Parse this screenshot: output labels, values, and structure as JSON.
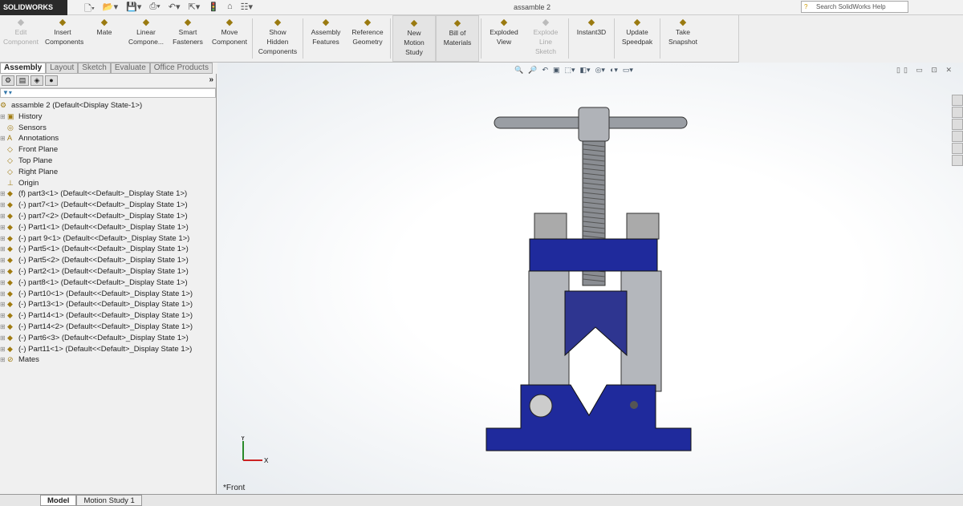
{
  "app": {
    "logo": "SOLIDWORKS",
    "title": "assamble 2",
    "search_placeholder": "Search SolidWorks Help"
  },
  "ribbon": [
    {
      "label": "Edit Component",
      "disabled": true
    },
    {
      "label": "Insert Components"
    },
    {
      "label": "Mate"
    },
    {
      "label": "Linear Compone..."
    },
    {
      "label": "Smart Fasteners"
    },
    {
      "label": "Move Component"
    },
    {
      "label": "Show Hidden Components"
    },
    {
      "label": "Assembly Features"
    },
    {
      "label": "Reference Geometry"
    },
    {
      "label": "New Motion Study",
      "active": true
    },
    {
      "label": "Bill of Materials",
      "active": true
    },
    {
      "label": "Exploded View"
    },
    {
      "label": "Explode Line Sketch",
      "disabled": true
    },
    {
      "label": "Instant3D"
    },
    {
      "label": "Update Speedpak"
    },
    {
      "label": "Take Snapshot"
    }
  ],
  "tabs": [
    "Assembly",
    "Layout",
    "Sketch",
    "Evaluate",
    "Office Products"
  ],
  "tree": [
    {
      "label": "assamble 2  (Default<Display State-1>)",
      "icon": "assembly",
      "root": true
    },
    {
      "label": "History",
      "icon": "history",
      "exp": true
    },
    {
      "label": "Sensors",
      "icon": "sensor"
    },
    {
      "label": "Annotations",
      "icon": "annotation",
      "exp": true
    },
    {
      "label": "Front Plane",
      "icon": "plane"
    },
    {
      "label": "Top Plane",
      "icon": "plane"
    },
    {
      "label": "Right Plane",
      "icon": "plane"
    },
    {
      "label": "Origin",
      "icon": "origin"
    },
    {
      "label": "(f) part3<1> (Default<<Default>_Display State 1>)",
      "icon": "part",
      "exp": true
    },
    {
      "label": "(-) part7<1> (Default<<Default>_Display State 1>)",
      "icon": "part",
      "exp": true
    },
    {
      "label": "(-) part7<2> (Default<<Default>_Display State 1>)",
      "icon": "part",
      "exp": true
    },
    {
      "label": "(-) Part1<1> (Default<<Default>_Display State 1>)",
      "icon": "part",
      "exp": true
    },
    {
      "label": "(-) part 9<1> (Default<<Default>_Display State 1>)",
      "icon": "part",
      "exp": true
    },
    {
      "label": "(-) Part5<1> (Default<<Default>_Display State 1>)",
      "icon": "part",
      "exp": true
    },
    {
      "label": "(-) Part5<2> (Default<<Default>_Display State 1>)",
      "icon": "part",
      "exp": true
    },
    {
      "label": "(-) Part2<1> (Default<<Default>_Display State 1>)",
      "icon": "part",
      "exp": true
    },
    {
      "label": "(-) part8<1> (Default<<Default>_Display State 1>)",
      "icon": "part",
      "exp": true
    },
    {
      "label": "(-) Part10<1> (Default<<Default>_Display State 1>)",
      "icon": "part",
      "exp": true
    },
    {
      "label": "(-) Part13<1> (Default<<Default>_Display State 1>)",
      "icon": "part",
      "exp": true
    },
    {
      "label": "(-) Part14<1> (Default<<Default>_Display State 1>)",
      "icon": "part",
      "exp": true
    },
    {
      "label": "(-) Part14<2> (Default<<Default>_Display State 1>)",
      "icon": "part",
      "exp": true
    },
    {
      "label": "(-) Part6<3> (Default<<Default>_Display State 1>)",
      "icon": "part",
      "exp": true
    },
    {
      "label": "(-) Part11<1> (Default<<Default>_Display State 1>)",
      "icon": "part",
      "exp": true
    },
    {
      "label": "Mates",
      "icon": "mates",
      "exp": true
    }
  ],
  "viewport": {
    "view_name": "*Front",
    "triad_x": "X",
    "triad_y": "Y",
    "part_color": "#1f2a9c"
  },
  "bottom_tabs": [
    "Model",
    "Motion Study 1"
  ]
}
